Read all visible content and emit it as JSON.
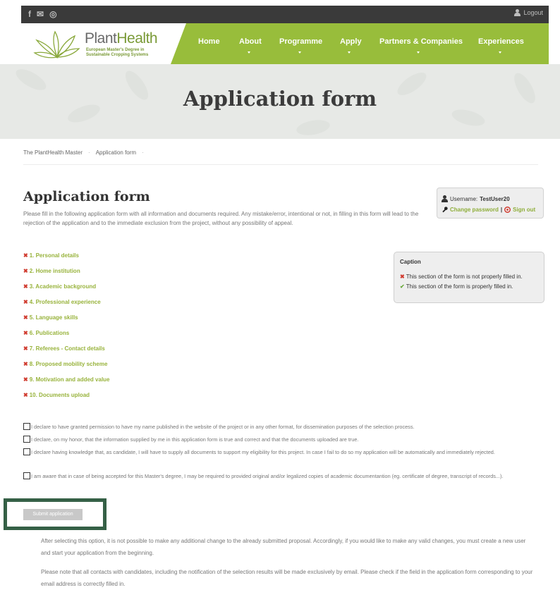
{
  "topbar": {
    "social": [
      {
        "name": "facebook-icon",
        "glyph": "f"
      },
      {
        "name": "twitter-icon",
        "glyph": "✉"
      },
      {
        "name": "instagram-icon",
        "glyph": "◎"
      }
    ],
    "logout_label": "Logout"
  },
  "brand": {
    "name_part1": "Plant",
    "name_part2": "Health",
    "tagline_1": "European Master's Degree in",
    "tagline_2": "Sustainable Cropping Systems"
  },
  "nav": {
    "home": "Home",
    "about": "About",
    "programme": "Programme",
    "apply": "Apply",
    "partners": "Partners & Companies",
    "experiences": "Experiences"
  },
  "hero": {
    "title": "Application form"
  },
  "breadcrumb": {
    "item1": "The PlantHealth Master",
    "item2": "Application form"
  },
  "page": {
    "heading": "Application form",
    "intro": "Please fill in the following application form with all information and documents required. Any mistake/error, intentional or not, in filling in this form will lead to the rejection of the application and to the immediate exclusion from the project, without any possibility of appeal."
  },
  "user": {
    "username_label": "Username:",
    "username": "TestUser20",
    "change_password": "Change password",
    "divider": "|",
    "sign_out": "Sign out"
  },
  "sections": [
    {
      "mark": "✖",
      "label": "1. Personal details"
    },
    {
      "mark": "✖",
      "label": "2. Home institution"
    },
    {
      "mark": "✖",
      "label": "3. Academic background"
    },
    {
      "mark": "✖",
      "label": "4. Professional experience"
    },
    {
      "mark": "✖",
      "label": "5. Language skills"
    },
    {
      "mark": "✖",
      "label": "6. Publications"
    },
    {
      "mark": "✖",
      "label": "7. Referees - Contact details"
    },
    {
      "mark": "✖",
      "label": "8. Proposed mobility scheme"
    },
    {
      "mark": "✖",
      "label": "9. Motivation and added value"
    },
    {
      "mark": "✖",
      "label": "10. Documents upload"
    }
  ],
  "caption": {
    "title": "Caption",
    "not_filled_mark": "✖",
    "not_filled": "This section of the form is not properly filled in.",
    "filled_mark": "✔",
    "filled": "This section of the form is properly filled in."
  },
  "declarations": [
    "I declare to have granted permission to have my name published in the website of the project or in any other format, for dissemination purposes of the selection process.",
    "I declare, on my honor, that the information supplied by me in this application form is true and correct and that the documents uploaded are true.",
    "I declare having knowledge that, as candidate, I will have to supply all documents to support my eligibility for this project. In case I fail to do so my application will be automatically and immediately rejected.",
    "I am aware that in case of being accepted for this Master's degree, I may be required to provided original and/or legalized copies of academic documentantion (eg. certificate of degree, transcript of records...)."
  ],
  "submit_label": "Submit application",
  "notes": [
    "After selecting this option, it is not possible to make any additional change to the already submitted proposal. Accordingly, if you would like to make any valid changes, you must create a new user and start your application from the beginning.",
    "Please note that all contacts with candidates, including the notification of the selection results will be made exclusively by email. Please check if the field in the application form corresponding to your email address is correctly filled in."
  ],
  "colors": {
    "nav_green": "#98bd3b",
    "link_green": "#98b33c",
    "error_red": "#d03b2f",
    "ok_green": "#69a83a",
    "highlight_outline": "#356046"
  }
}
